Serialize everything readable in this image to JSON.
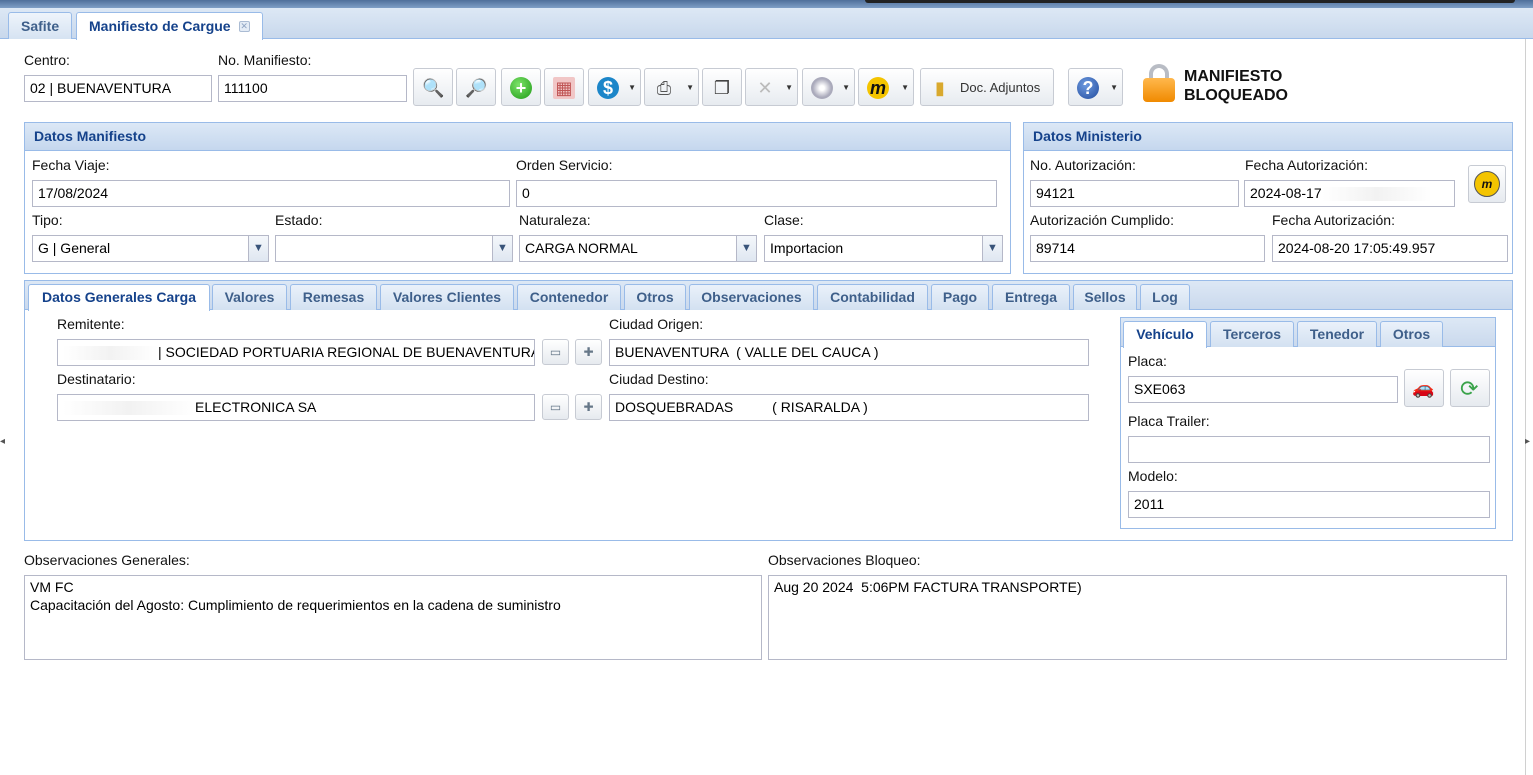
{
  "tabs": [
    {
      "label": "Safite"
    },
    {
      "label": "Manifiesto de Cargue"
    }
  ],
  "header": {
    "centro_label": "Centro:",
    "centro_value": "02 | BUENAVENTURA",
    "manifiesto_label": "No. Manifiesto:",
    "manifiesto_value": "111100",
    "doc_adjuntos": "Doc. Adjuntos",
    "status_line1": "MANIFIESTO",
    "status_line2": "BLOQUEADO"
  },
  "toolbar_icons": [
    "search-icon",
    "search-detail-icon",
    "add-icon",
    "document-icon",
    "money-icon",
    "printer-icon",
    "copy-icon",
    "tooth-icon",
    "disc-icon",
    "ministry-user-icon",
    "folder-icon",
    "help-icon"
  ],
  "datos_manifiesto": {
    "title": "Datos Manifiesto",
    "fecha_viaje_label": "Fecha Viaje:",
    "fecha_viaje_value": "17/08/2024",
    "orden_servicio_label": "Orden Servicio:",
    "orden_servicio_value": "0",
    "tipo_label": "Tipo:",
    "tipo_value": "G | General",
    "estado_label": "Estado:",
    "estado_value": "",
    "naturaleza_label": "Naturaleza:",
    "naturaleza_value": "CARGA NORMAL",
    "clase_label": "Clase:",
    "clase_value": "Importacion"
  },
  "datos_ministerio": {
    "title": "Datos Ministerio",
    "no_autorizacion_label": "No. Autorización:",
    "no_autorizacion_value": "94121",
    "fecha_autorizacion_label": "Fecha Autorización:",
    "fecha_autorizacion_value": "2024-08-17",
    "autorizacion_cumplido_label": "Autorización Cumplido:",
    "autorizacion_cumplido_value": "89714",
    "fecha_autorizacion2_label": "Fecha Autorización:",
    "fecha_autorizacion2_value": "2024-08-20 17:05:49.957"
  },
  "subtabs": [
    {
      "label": "Datos Generales Carga"
    },
    {
      "label": "Valores"
    },
    {
      "label": "Remesas"
    },
    {
      "label": "Valores Clientes"
    },
    {
      "label": "Contenedor"
    },
    {
      "label": "Otros"
    },
    {
      "label": "Observaciones"
    },
    {
      "label": "Contabilidad"
    },
    {
      "label": "Pago"
    },
    {
      "label": "Entrega"
    },
    {
      "label": "Sellos"
    },
    {
      "label": "Log"
    }
  ],
  "carga": {
    "remitente_label": "Remitente:",
    "remitente_value": "| SOCIEDAD PORTUARIA REGIONAL DE BUENAVENTURA",
    "destinatario_label": "Destinatario:",
    "destinatario_value": "ELECTRONICA SA",
    "ciudad_origen_label": "Ciudad Origen:",
    "ciudad_origen_value": "BUENAVENTURA  ( VALLE DEL CAUCA )",
    "ciudad_destino_label": "Ciudad Destino:",
    "ciudad_destino_value": "DOSQUEBRADAS          ( RISARALDA )"
  },
  "vehiculo_tabs": [
    {
      "label": "Vehículo"
    },
    {
      "label": "Terceros"
    },
    {
      "label": "Tenedor"
    },
    {
      "label": "Otros"
    }
  ],
  "vehiculo": {
    "placa_label": "Placa:",
    "placa_value": "SXE063",
    "placa_trailer_label": "Placa Trailer:",
    "placa_trailer_value": "",
    "modelo_label": "Modelo:",
    "modelo_value": "2011"
  },
  "observaciones": {
    "generales_label": "Observaciones Generales:",
    "generales_text": "VM FC\nCapacitación del Agosto: Cumplimiento de requerimientos en la cadena de suministro",
    "bloqueo_label": "Observaciones Bloqueo:",
    "bloqueo_text": "Aug 20 2024  5:06PM FACTURA TRANSPORTE)"
  },
  "colors": {
    "panel_header_text": "#15428b",
    "panel_border": "#99bbe8",
    "lock_orange": "#f08a00"
  }
}
